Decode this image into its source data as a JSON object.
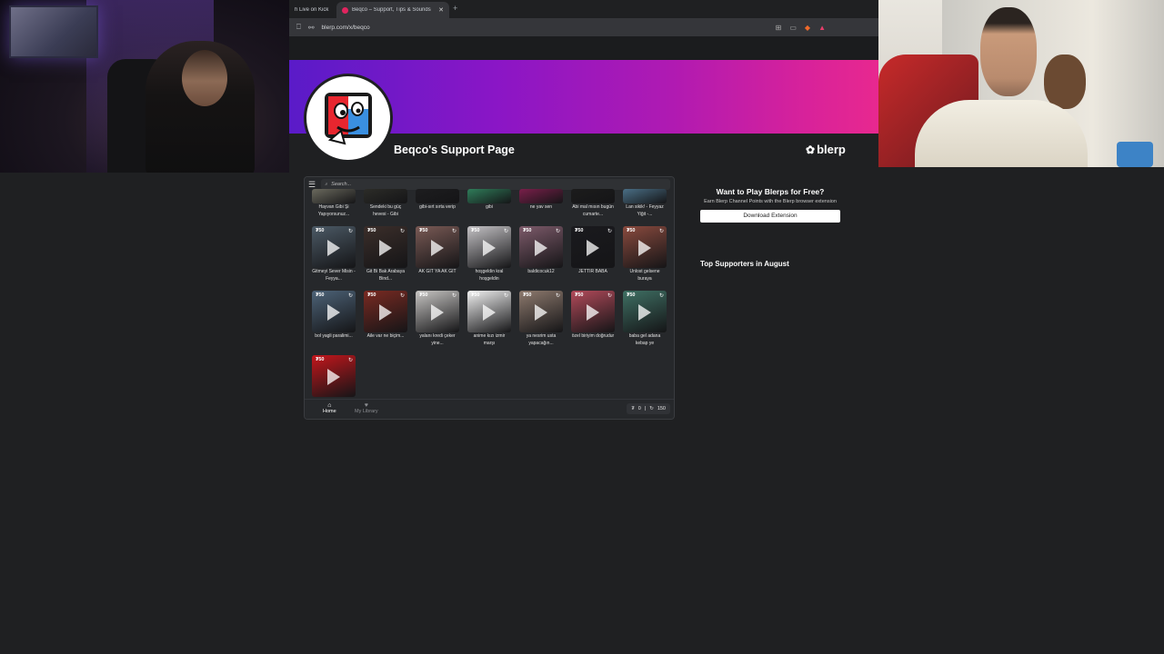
{
  "browser": {
    "tabs": [
      {
        "title": "h Live on Kick"
      },
      {
        "title": "Beqco – Support, Tips & Sounds"
      }
    ],
    "url": "blerp.com/x/beqco"
  },
  "page": {
    "title": "Beqco's Support Page",
    "brand": "blerp"
  },
  "widget": {
    "search_placeholder": "Search...",
    "tiles": [
      {
        "label": "Hayvan Gibi Şi Yapıyorsunuz...",
        "price": "",
        "color": "#6b6a5e"
      },
      {
        "label": "Sendeki bu güç hevesi - Gibi",
        "price": "",
        "color": "#2c2c28"
      },
      {
        "label": "gibi-sırt sırta verip",
        "price": "",
        "color": "#1d1d1f"
      },
      {
        "label": "gibi",
        "price": "",
        "color": "#2f7d5a"
      },
      {
        "label": "ne yav sen",
        "price": "",
        "color": "#7a1f4a"
      },
      {
        "label": "Abi mal mısın bugün cumarte...",
        "price": "",
        "color": "#1c1c1c"
      },
      {
        "label": "Lan sikik! - Feyyaz Yiğit -...",
        "price": "",
        "color": "#4a6f86"
      },
      {
        "label": "Gitmeyi Sever Misin - Feyya...",
        "price": "50",
        "color": "#4c5a66"
      },
      {
        "label": "Git Bi Bak Arabaya Bind...",
        "price": "50",
        "color": "#3b2e2a"
      },
      {
        "label": "AK GİT YA AK GİT",
        "price": "50",
        "color": "#7a5a55"
      },
      {
        "label": "hoşgeldin kral hoşgeldin",
        "price": "50",
        "color": "#c4c2c5"
      },
      {
        "label": "baldicocuk12",
        "price": "50",
        "color": "#7d5a6a"
      },
      {
        "label": "JETTIR BABA",
        "price": "50",
        "color": "#1a1a1e"
      },
      {
        "label": "Unlost gelsene buraya",
        "price": "50",
        "color": "#8a4a3e"
      },
      {
        "label": "bol yagli paralimi...",
        "price": "50",
        "color": "#4d6378"
      },
      {
        "label": "Aile var ne biçim...",
        "price": "50",
        "color": "#7a2a22"
      },
      {
        "label": "yalanı kredi çeker yine...",
        "price": "50",
        "color": "#c8c6c4"
      },
      {
        "label": "anime kızı izmir marşı",
        "price": "50",
        "color": "#f2f2f2"
      },
      {
        "label": "ya nesrim usta yapacağın...",
        "price": "50",
        "color": "#8e7a6e"
      },
      {
        "label": "özel biriyim doğrudur",
        "price": "50",
        "color": "#b24a5a"
      },
      {
        "label": "baba gel adana kebap ye",
        "price": "50",
        "color": "#3f7064"
      },
      {
        "label": "",
        "price": "50",
        "color": "#c4161c"
      }
    ],
    "nav": {
      "home": "Home",
      "library": "My Library"
    },
    "balance": {
      "points": "0",
      "credits": "150"
    }
  },
  "promo": {
    "title": "Want to Play Blerps for Free?",
    "desc": "Earn Blerp Channel Points with the Blerp browser extension",
    "button": "Download Extension"
  },
  "supporters_title": "Top Supporters in August"
}
